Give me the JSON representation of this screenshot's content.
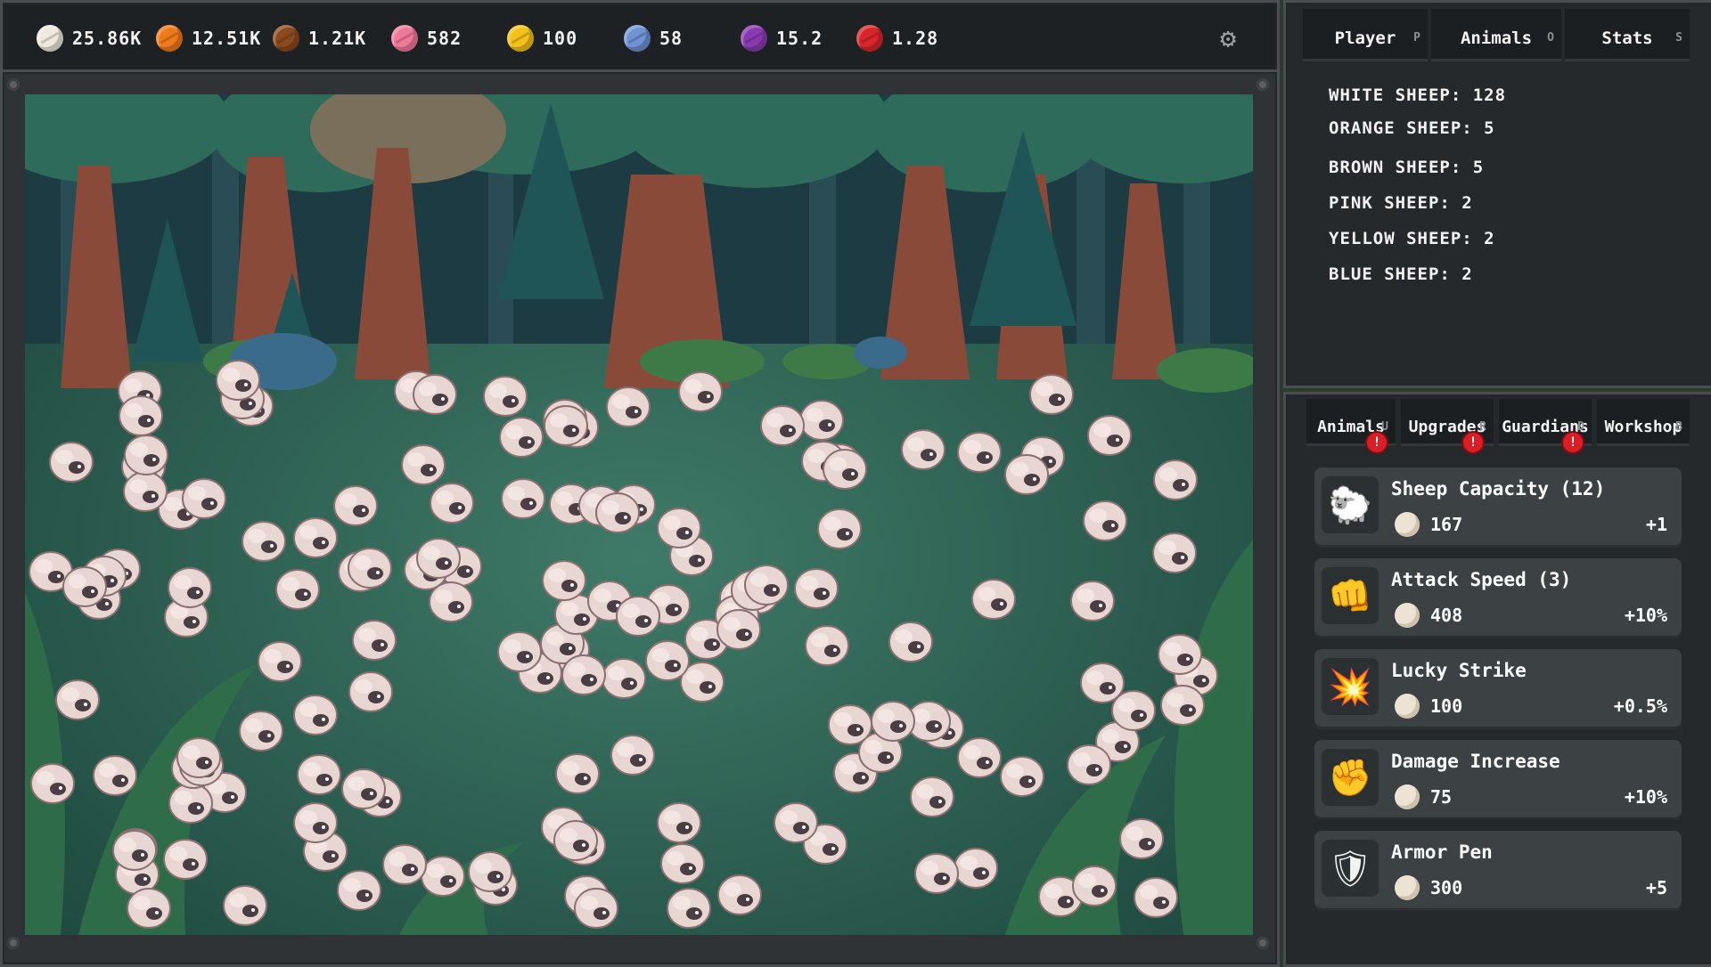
{
  "resources": [
    {
      "name": "white-yarn",
      "value": "25.86K",
      "color": "#efe8dd"
    },
    {
      "name": "orange-yarn",
      "value": "12.51K",
      "color": "#ef7a1c"
    },
    {
      "name": "brown-yarn",
      "value": "1.21K",
      "color": "#8a4a1c"
    },
    {
      "name": "pink-yarn",
      "value": "582",
      "color": "#ef7a98"
    },
    {
      "name": "yellow-yarn",
      "value": "100",
      "color": "#f2c21a"
    },
    {
      "name": "blue-yarn",
      "value": "58",
      "color": "#6f93d4"
    },
    {
      "name": "purple-yarn",
      "value": "15.2",
      "color": "#8a3ab0"
    },
    {
      "name": "red-yarn",
      "value": "1.28",
      "color": "#d8262a"
    }
  ],
  "top_tabs": [
    {
      "label": "Player",
      "key": "P"
    },
    {
      "label": "Animals",
      "key": "O"
    },
    {
      "label": "Stats",
      "key": "S"
    }
  ],
  "animal_counts": [
    "WHITE SHEEP: 128",
    "ORANGE SHEEP: 5",
    "BROWN SHEEP: 5",
    "PINK SHEEP: 2",
    "YELLOW SHEEP: 2",
    "BLUE SHEEP: 2"
  ],
  "bottom_tabs": [
    {
      "label": "Animals",
      "key": "U",
      "alert": "!"
    },
    {
      "label": "Upgrades",
      "key": "R",
      "alert": "!"
    },
    {
      "label": "Guardians",
      "key": "D",
      "alert": "!"
    },
    {
      "label": "Workshop",
      "key": "B",
      "alert": ""
    }
  ],
  "upgrades": [
    {
      "title": "Sheep Capacity (12)",
      "cost": "167",
      "gain": "+1",
      "icon": "sheep-face-icon"
    },
    {
      "title": "Attack Speed (3)",
      "cost": "408",
      "gain": "+10%",
      "icon": "fast-fist-icon"
    },
    {
      "title": "Lucky Strike",
      "cost": "100",
      "gain": "+0.5%",
      "icon": "explosion-icon"
    },
    {
      "title": "Damage Increase",
      "cost": "75",
      "gain": "+10%",
      "icon": "fist-up-icon"
    },
    {
      "title": "Armor Pen",
      "cost": "300",
      "gain": "+5",
      "icon": "shield-icon"
    }
  ],
  "colors": {
    "forest_ground": "#2f5a4e",
    "sheep_wool": "#e8d6d2",
    "alert": "#d81f26"
  }
}
